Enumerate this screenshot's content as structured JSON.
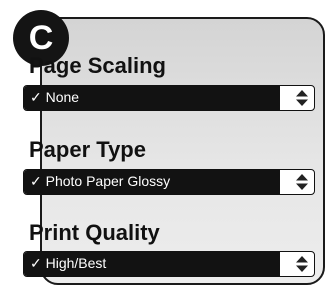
{
  "badge": {
    "letter": "C"
  },
  "settings": [
    {
      "title": "Page Scaling",
      "value": "✓ None"
    },
    {
      "title": "Paper Type",
      "value": "✓ Photo Paper Glossy"
    },
    {
      "title": "Print Quality",
      "value": "✓ High/Best"
    }
  ],
  "icons": {
    "popup_arrows": "up-down-arrows-icon"
  },
  "colors": {
    "selected_bg": "#121212",
    "panel_bg": "#e0e0e0",
    "badge_bg": "#141414"
  }
}
